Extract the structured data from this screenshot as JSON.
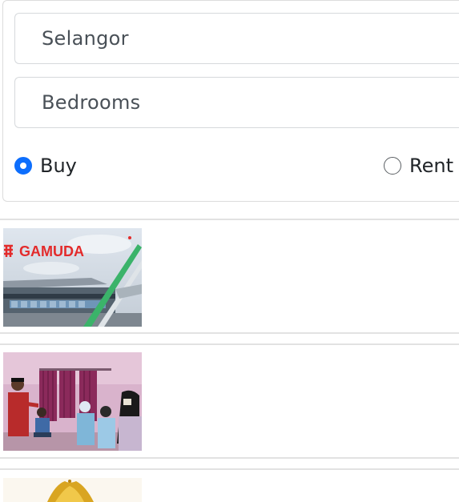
{
  "search": {
    "state_value": "Selangor",
    "bedrooms_placeholder": "Bedrooms",
    "listing_type": {
      "options": [
        {
          "label": "Buy",
          "checked": true
        },
        {
          "label": "Rent",
          "checked": false
        }
      ]
    }
  },
  "news": {
    "items": [
      {
        "thumbnail_icon": "train-station-image",
        "thumbnail_logo_text": "GAMUDA"
      },
      {
        "thumbnail_icon": "people-indoor-image"
      },
      {
        "thumbnail_icon": "gold-ornament-image"
      }
    ]
  },
  "colors": {
    "accent": "#0d6efd",
    "brand_red": "#e32b2b",
    "border": "#d6d9dc"
  }
}
